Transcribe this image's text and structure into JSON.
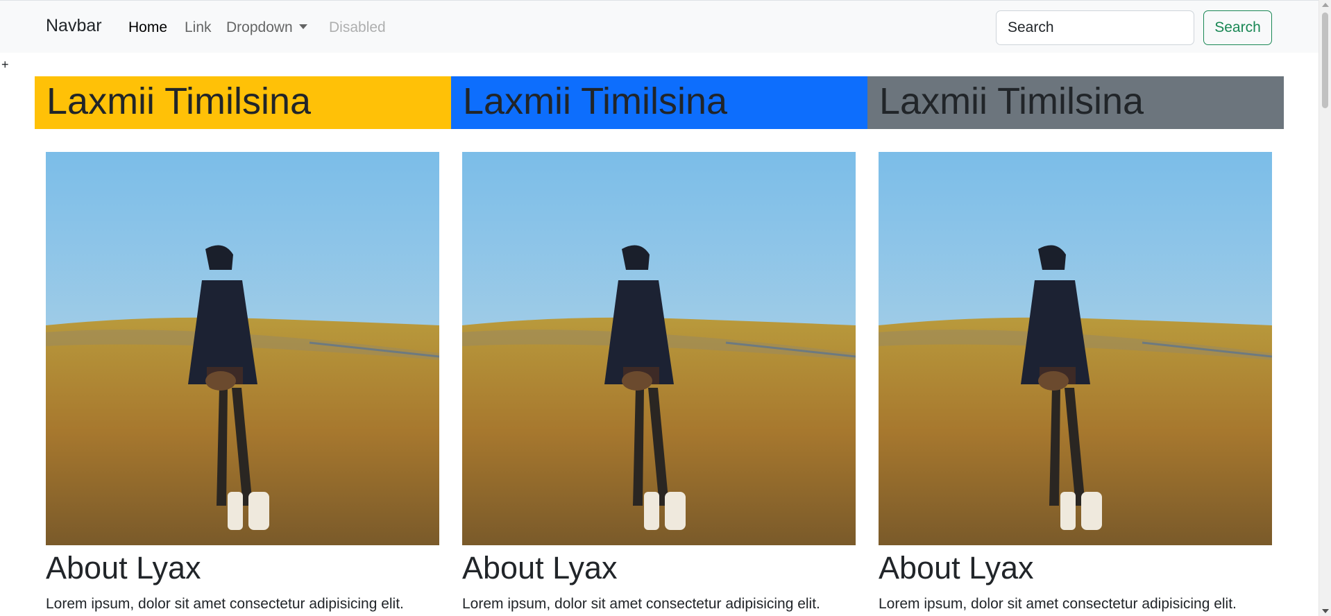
{
  "navbar": {
    "brand": "Navbar",
    "links": [
      {
        "label": "Home",
        "state": "active"
      },
      {
        "label": "Link",
        "state": "normal"
      },
      {
        "label": "Dropdown",
        "state": "dropdown"
      },
      {
        "label": "Disabled",
        "state": "disabled"
      }
    ],
    "search_placeholder": "Search",
    "search_button": "Search"
  },
  "stray_text": "+",
  "banners": [
    {
      "text": "Laxmii Timilsina",
      "color": "#ffc107"
    },
    {
      "text": "Laxmii Timilsina",
      "color": "#0d6efd"
    },
    {
      "text": "Laxmii Timilsina",
      "color": "#6c757d"
    }
  ],
  "cards": [
    {
      "title": "About Lyax",
      "text": "Lorem ipsum, dolor sit amet consectetur adipisicing elit."
    },
    {
      "title": "About Lyax",
      "text": "Lorem ipsum, dolor sit amet consectetur adipisicing elit."
    },
    {
      "title": "About Lyax",
      "text": "Lorem ipsum, dolor sit amet consectetur adipisicing elit."
    }
  ],
  "colors": {
    "accent_success": "#198754",
    "navbar_bg": "#f8f9fa"
  }
}
